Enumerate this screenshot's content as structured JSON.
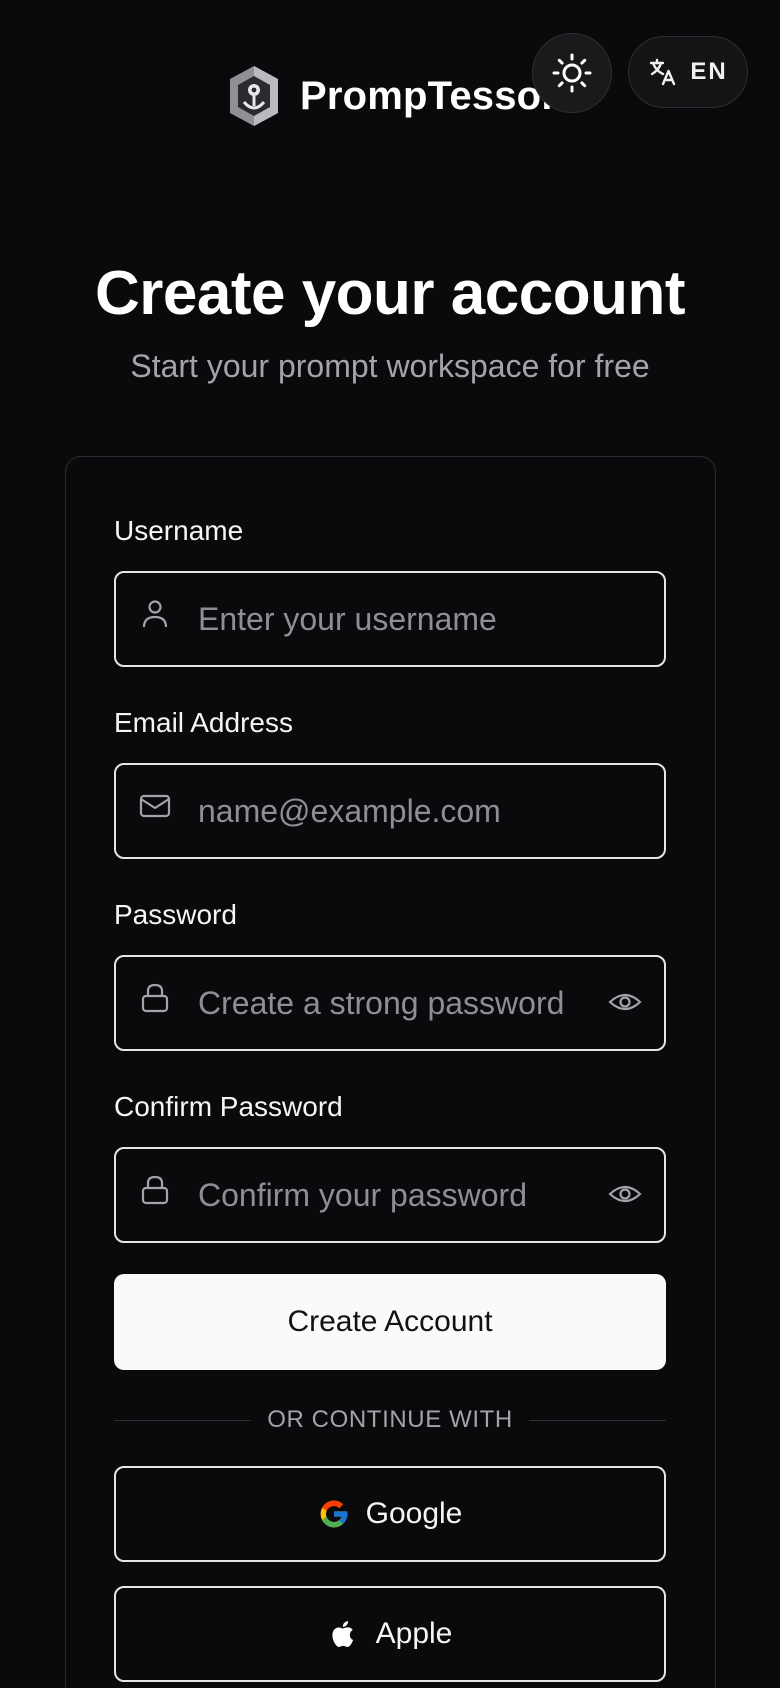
{
  "header": {
    "brand_name": "PrompTessor",
    "language_label": "EN"
  },
  "hero": {
    "title": "Create your account",
    "subtitle": "Start your prompt workspace for free"
  },
  "form": {
    "username": {
      "label": "Username",
      "placeholder": "Enter your username",
      "value": ""
    },
    "email": {
      "label": "Email Address",
      "placeholder": "name@example.com",
      "value": ""
    },
    "password": {
      "label": "Password",
      "placeholder": "Create a strong password",
      "value": ""
    },
    "confirm_password": {
      "label": "Confirm Password",
      "placeholder": "Confirm your password",
      "value": ""
    },
    "submit_label": "Create Account",
    "divider_text": "OR CONTINUE WITH",
    "social": {
      "google_label": "Google",
      "apple_label": "Apple"
    }
  },
  "icons": {
    "logo": "robot-shield-logo",
    "theme": "sun-icon",
    "language": "translate-icon",
    "username": "user-icon",
    "email": "mail-icon",
    "password": "lock-icon",
    "reveal": "eye-icon",
    "google": "google-icon",
    "apple": "apple-icon"
  },
  "colors": {
    "background": "#0a0a0c",
    "card_border": "#2c2c30",
    "primary_button": "#fafafa",
    "muted_text": "#a3a3a8",
    "placeholder": "#8e8e94"
  }
}
